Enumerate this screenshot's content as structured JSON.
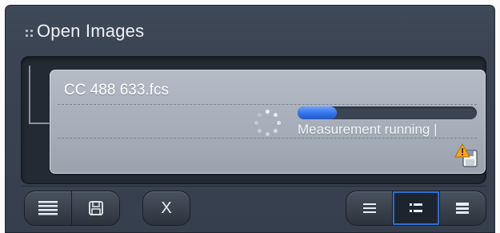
{
  "panel": {
    "title": "Open Images"
  },
  "image_item": {
    "filename": "CC 488 633.fcs",
    "status": "Measurement running |",
    "progress": 0.22,
    "warning_icon": "warning-save-icon"
  },
  "toolbar": {
    "close_label": "X",
    "left_group": [
      "list-view-icon",
      "save-icon"
    ],
    "right_group": [
      "view-list-icon",
      "view-details-icon",
      "view-compact-icon"
    ],
    "active_view": "view-details-icon"
  },
  "colors": {
    "panel_bg": "#3a4453",
    "card_bg": "#a6aeba",
    "progress_fill": "#2f6fe6",
    "warning": "#f5a623",
    "active_outline": "#2f6fd0"
  }
}
